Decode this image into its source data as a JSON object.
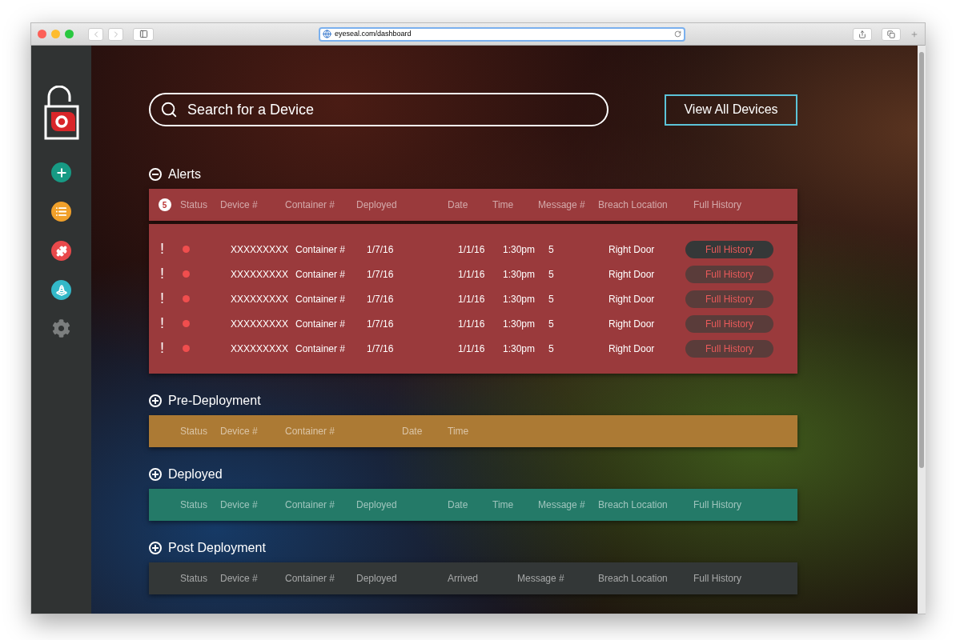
{
  "browser": {
    "url": "eyeseal.com/dashboard"
  },
  "search": {
    "placeholder": "Search for a Device"
  },
  "view_all_button": "View All Devices",
  "sections": [
    {
      "title": "Alerts",
      "expanded": true,
      "color": "#9a3a3c",
      "badge": "5",
      "columns": [
        "Status",
        "Device #",
        "Container #",
        "Deployed",
        "Date",
        "Time",
        "Message #",
        "Breach Location",
        "Full History"
      ],
      "rows": [
        {
          "flag": "!",
          "device": "XXXXXXXXX",
          "container": "Container #",
          "deployed": "1/7/16",
          "date": "1/1/16",
          "time": "1:30pm",
          "message": "5",
          "breach_location": "Right Door",
          "button": "Full History",
          "selected": true
        },
        {
          "flag": "!",
          "device": "XXXXXXXXX",
          "container": "Container #",
          "deployed": "1/7/16",
          "date": "1/1/16",
          "time": "1:30pm",
          "message": "5",
          "breach_location": "Right Door",
          "button": "Full History",
          "selected": false
        },
        {
          "flag": "!",
          "device": "XXXXXXXXX",
          "container": "Container #",
          "deployed": "1/7/16",
          "date": "1/1/16",
          "time": "1:30pm",
          "message": "5",
          "breach_location": "Right Door",
          "button": "Full History",
          "selected": false
        },
        {
          "flag": "!",
          "device": "XXXXXXXXX",
          "container": "Container #",
          "deployed": "1/7/16",
          "date": "1/1/16",
          "time": "1:30pm",
          "message": "5",
          "breach_location": "Right Door",
          "button": "Full History",
          "selected": false
        },
        {
          "flag": "!",
          "device": "XXXXXXXXX",
          "container": "Container #",
          "deployed": "1/7/16",
          "date": "1/1/16",
          "time": "1:30pm",
          "message": "5",
          "breach_location": "Right Door",
          "button": "Full History",
          "selected": false
        }
      ]
    },
    {
      "title": "Pre-Deployment",
      "expanded": false,
      "color": "#ac7a34",
      "columns": [
        "Status",
        "Device #",
        "Container #",
        "Date",
        "Time"
      ]
    },
    {
      "title": "Deployed",
      "expanded": false,
      "color": "#247a68",
      "columns": [
        "Status",
        "Device #",
        "Container #",
        "Deployed",
        "Date",
        "Time",
        "Message #",
        "Breach Location",
        "Full History"
      ]
    },
    {
      "title": "Post Deployment",
      "expanded": false,
      "color": "#333737",
      "columns": [
        "Status",
        "Device #",
        "Container #",
        "Deployed",
        "Arrived",
        "Message #",
        "Breach Location",
        "Full History"
      ]
    }
  ]
}
